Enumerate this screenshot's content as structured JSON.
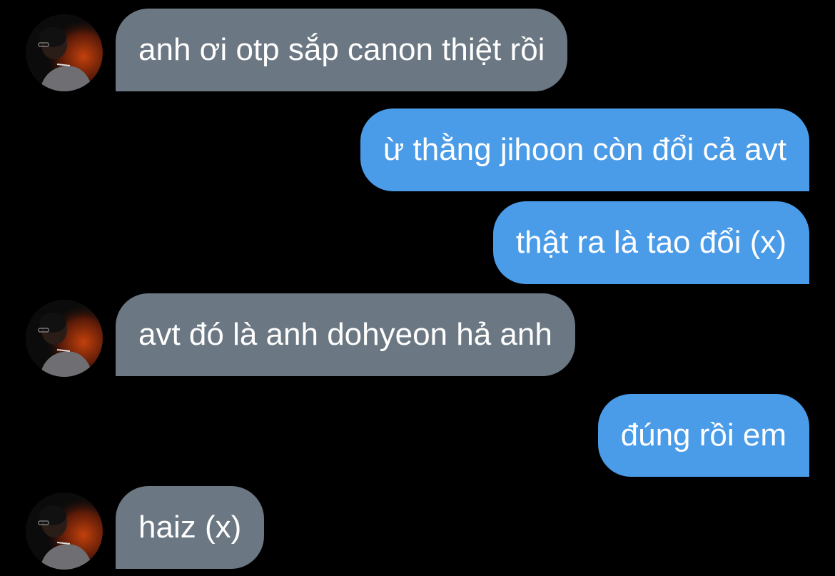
{
  "conversation": {
    "messages": [
      {
        "sender": "other",
        "text": "anh ơi otp sắp canon thiệt rồi",
        "has_avatar": true
      },
      {
        "sender": "me",
        "text": "ừ thằng jihoon còn đổi cả avt"
      },
      {
        "sender": "me",
        "text": "thật ra là tao đổi (x)"
      },
      {
        "sender": "other",
        "text": "avt đó là anh dohyeon hả anh",
        "has_avatar": true
      },
      {
        "sender": "me",
        "text": "đúng rồi em"
      },
      {
        "sender": "other",
        "text": "haiz (x)",
        "has_avatar": true
      }
    ]
  },
  "colors": {
    "background": "#000000",
    "incoming_bubble": "#6b7782",
    "outgoing_bubble": "#4a9be8",
    "text": "#ffffff"
  },
  "icons": {
    "avatar": "contact-avatar-photo"
  }
}
